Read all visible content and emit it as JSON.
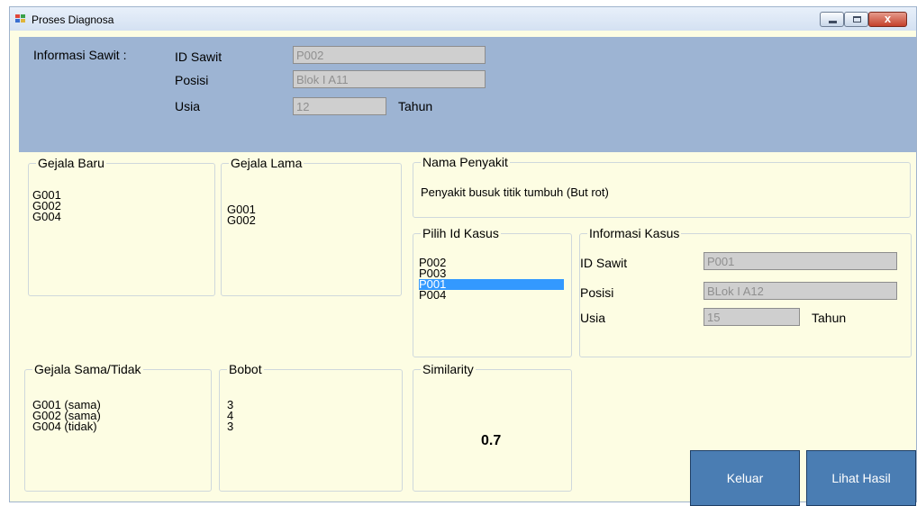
{
  "window": {
    "title": "Proses Diagnosa",
    "close_label": "x"
  },
  "info_sawit": {
    "heading": "Informasi Sawit :",
    "id_label": "ID Sawit",
    "id_value": "P002",
    "posisi_label": "Posisi",
    "posisi_value": "Blok I A11",
    "usia_label": "Usia",
    "usia_value": "12",
    "tahun_label": "Tahun"
  },
  "gejala_baru": {
    "title": "Gejala Baru",
    "items": [
      "G001",
      "G002",
      "G004"
    ]
  },
  "gejala_lama": {
    "title": "Gejala Lama",
    "items": [
      "G001",
      "G002"
    ]
  },
  "nama_penyakit": {
    "title": "Nama Penyakit",
    "value": "Penyakit busuk titik tumbuh (But rot)"
  },
  "pilih_id_kasus": {
    "title": "Pilih Id Kasus",
    "items": [
      "P002",
      "P003",
      "P001",
      "P004"
    ],
    "selected_index": 2
  },
  "informasi_kasus": {
    "title": "Informasi Kasus",
    "id_label": "ID Sawit",
    "id_value": "P001",
    "posisi_label": "Posisi",
    "posisi_value": "BLok I A12",
    "usia_label": "Usia",
    "usia_value": "15",
    "tahun_label": "Tahun"
  },
  "gejala_sama": {
    "title": "Gejala Sama/Tidak",
    "items": [
      "G001 (sama)",
      "G002 (sama)",
      "G004 (tidak)"
    ]
  },
  "bobot": {
    "title": "Bobot",
    "items": [
      "3",
      "4",
      "3"
    ]
  },
  "similarity": {
    "title": "Similarity",
    "value": "0.7"
  },
  "buttons": {
    "keluar": "Keluar",
    "lihat_hasil": "Lihat Hasil"
  },
  "colors": {
    "form_bg": "#fdfde3",
    "info_panel": "#9db4d3",
    "button": "#4a7db3",
    "selection": "#3399ff"
  }
}
